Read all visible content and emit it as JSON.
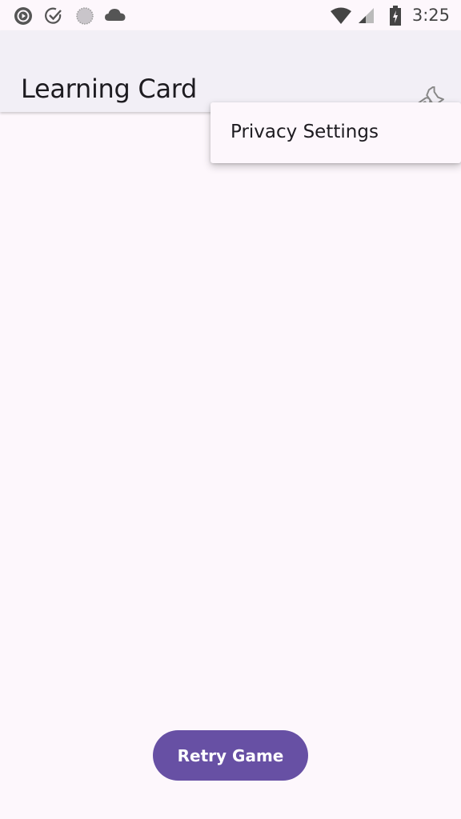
{
  "status_bar": {
    "time": "3:25",
    "left_icons": [
      "media-play-icon",
      "check-circle-icon",
      "sync-icon",
      "cloud-icon"
    ],
    "right_icons": [
      "wifi-icon",
      "cell-signal-icon",
      "battery-charging-icon"
    ]
  },
  "app_bar": {
    "title": "Learning Card",
    "action_icon": "wrench-icon"
  },
  "menu": {
    "items": [
      {
        "label": "Privacy Settings"
      }
    ]
  },
  "main": {
    "retry_label": "Retry Game",
    "accent_color": "#6750a4"
  }
}
